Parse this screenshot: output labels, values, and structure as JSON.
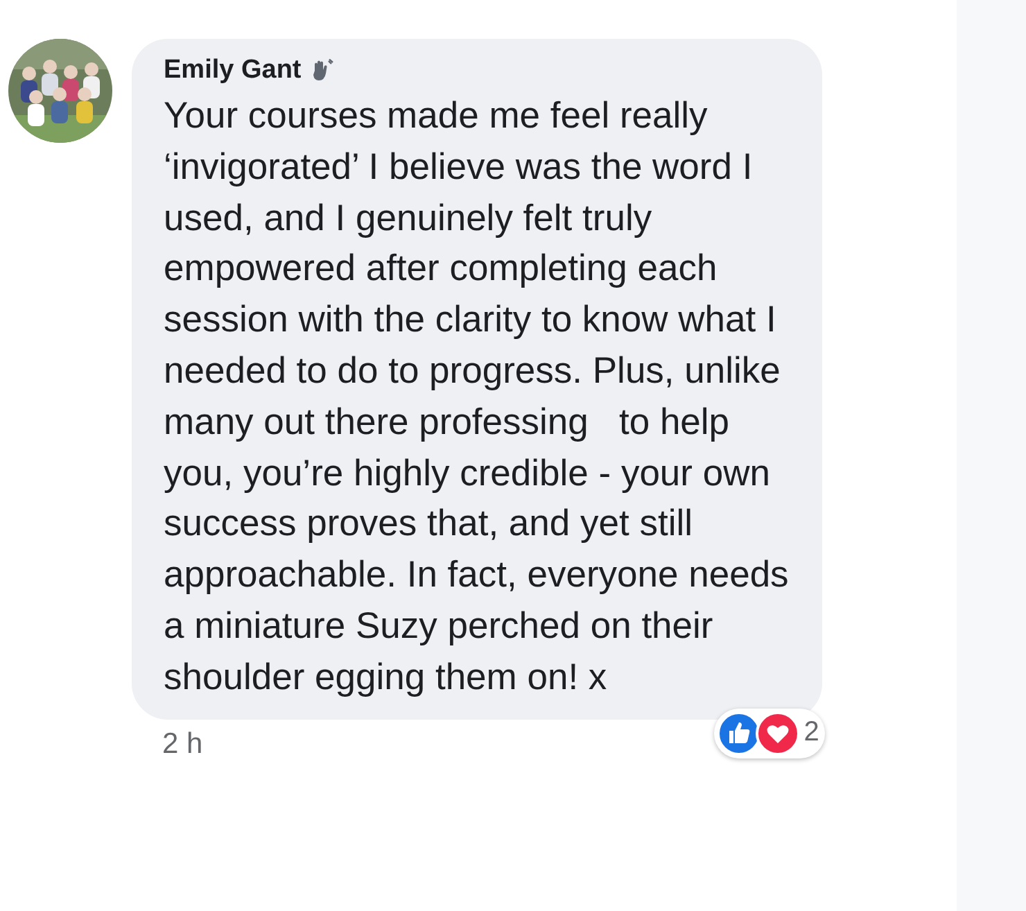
{
  "comment": {
    "author": "Emily Gant",
    "text": "Your courses made me feel really\n‘invigorated’ I believe was the word I\nused, and I genuinely felt truly\nempowered after completing each\nsession with the clarity to know what I\nneeded to do to progress. Plus, unlike\nmany out there professing   to help\nyou, you’re highly credible - your own\nsuccess proves that, and yet still\napproachable. In fact, everyone needs\na miniature Suzy perched on their\nshoulder egging them on! x",
    "time": "2 h",
    "reaction_count": "2"
  }
}
